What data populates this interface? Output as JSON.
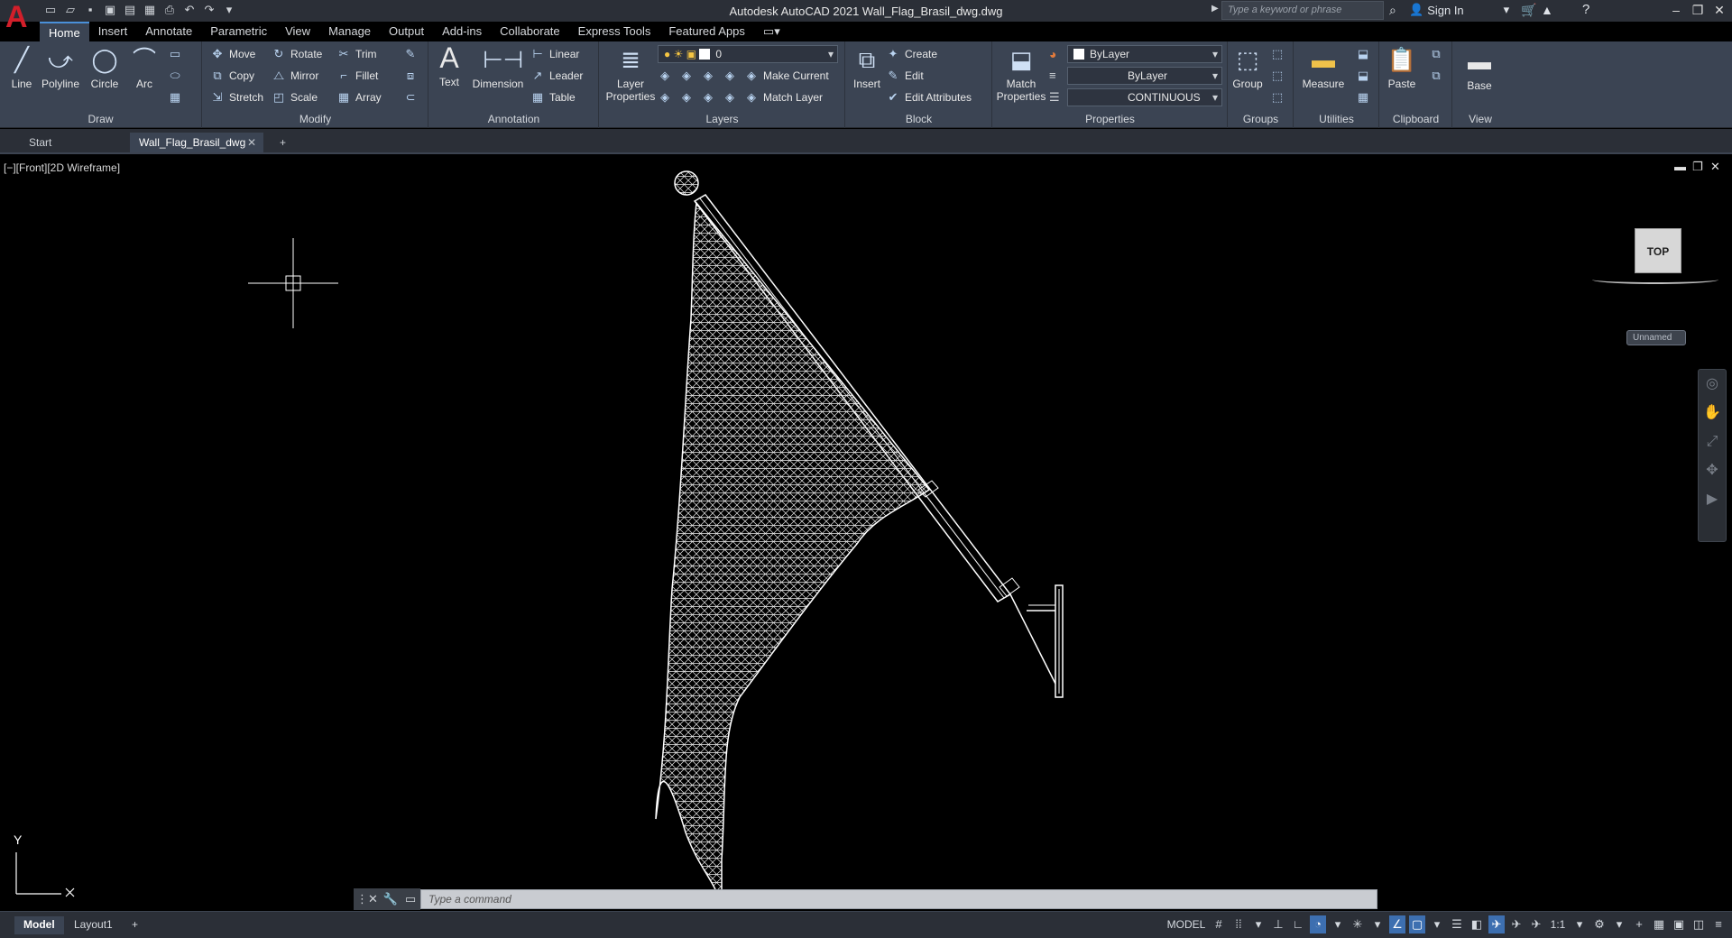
{
  "app": {
    "logo": "A",
    "title": "Autodesk AutoCAD 2021   Wall_Flag_Brasil_dwg.dwg",
    "search_placeholder": "Type a keyword or phrase",
    "sign_in": "Sign In"
  },
  "menu_tabs": [
    "Home",
    "Insert",
    "Annotate",
    "Parametric",
    "View",
    "Manage",
    "Output",
    "Add-ins",
    "Collaborate",
    "Express Tools",
    "Featured Apps"
  ],
  "ribbon": {
    "draw": {
      "label": "Draw",
      "line": "Line",
      "polyline": "Polyline",
      "circle": "Circle",
      "arc": "Arc"
    },
    "modify": {
      "label": "Modify",
      "move": "Move",
      "rotate": "Rotate",
      "trim": "Trim",
      "copy": "Copy",
      "mirror": "Mirror",
      "fillet": "Fillet",
      "stretch": "Stretch",
      "scale": "Scale",
      "array": "Array"
    },
    "annotation": {
      "label": "Annotation",
      "text": "Text",
      "dimension": "Dimension",
      "linear": "Linear",
      "leader": "Leader",
      "table": "Table"
    },
    "layers": {
      "label": "Layers",
      "layer_properties": "Layer Properties",
      "current_layer": "0",
      "make_current": "Make Current",
      "match_layer": "Match Layer"
    },
    "block": {
      "label": "Block",
      "insert": "Insert",
      "create": "Create",
      "edit": "Edit",
      "edit_attributes": "Edit Attributes"
    },
    "properties": {
      "label": "Properties",
      "match_properties": "Match Properties",
      "color": "ByLayer",
      "lineweight": "ByLayer",
      "linetype": "CONTINUOUS"
    },
    "groups": {
      "label": "Groups",
      "group": "Group"
    },
    "utilities": {
      "label": "Utilities",
      "measure": "Measure"
    },
    "clipboard": {
      "label": "Clipboard",
      "paste": "Paste"
    },
    "view": {
      "label": "View",
      "base": "Base"
    }
  },
  "doc_tabs": {
    "start": "Start",
    "active": "Wall_Flag_Brasil_dwg"
  },
  "viewport": {
    "label": "[−][Front][2D Wireframe]",
    "viewcube": "TOP",
    "ucs_name": "Unnamed",
    "axis_y": "Y"
  },
  "command": {
    "placeholder": "Type a command"
  },
  "layout_tabs": {
    "model": "Model",
    "layout1": "Layout1"
  },
  "status": {
    "model": "MODEL",
    "scale": "1:1"
  }
}
